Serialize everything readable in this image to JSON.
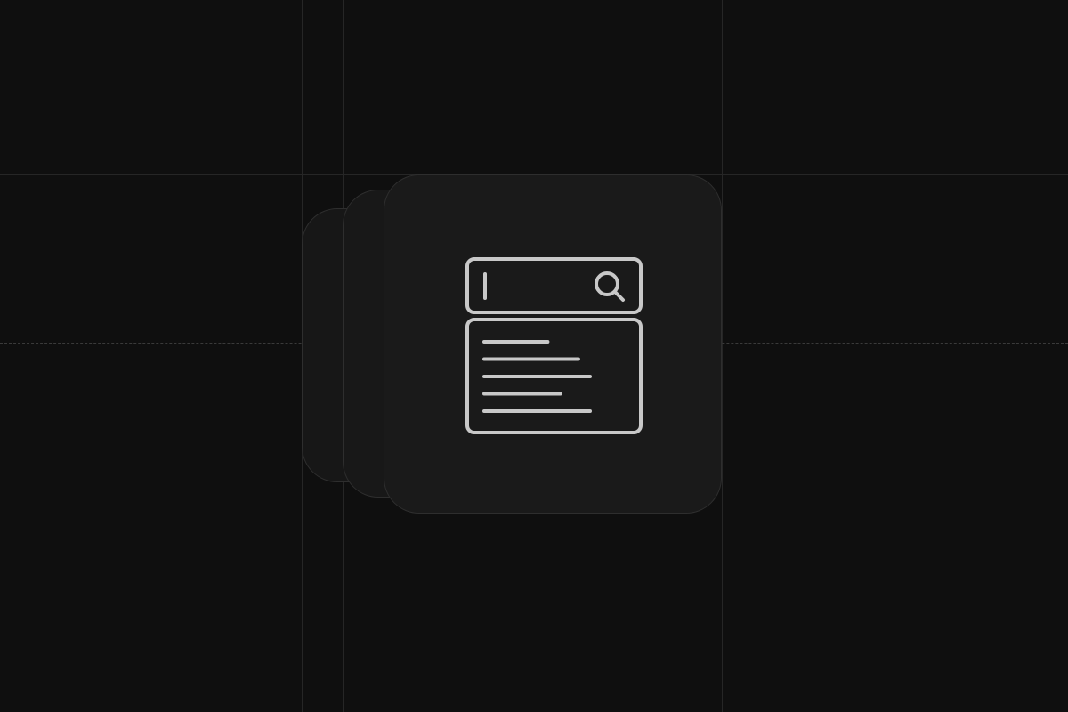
{
  "colors": {
    "background": "#0f0f0f",
    "card": "#1a1a1a",
    "card_border": "#2e2e2e",
    "grid_line": "#262626",
    "icon_stroke": "#c8c8c8"
  },
  "illustration": {
    "icon": "search-results-icon",
    "search_bar": {
      "icon": "magnifier-icon",
      "cursor": "text-cursor"
    },
    "result_lines": [
      0.6,
      0.89,
      1.0,
      0.72,
      1.0
    ]
  }
}
